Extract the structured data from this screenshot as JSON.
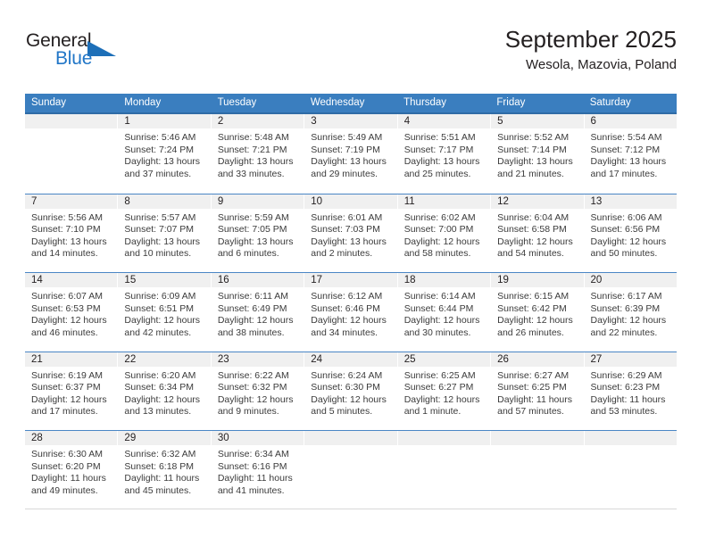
{
  "brand": {
    "name_part1": "General",
    "name_part2": "Blue",
    "triangle_color": "#1d6fb8",
    "blue_color": "#2176c7"
  },
  "header": {
    "title": "September 2025",
    "subtitle": "Wesola, Mazovia, Poland"
  },
  "calendar": {
    "header_bg": "#3a7ebf",
    "day_number_bg": "#f0f0f0",
    "weekdays": [
      "Sunday",
      "Monday",
      "Tuesday",
      "Wednesday",
      "Thursday",
      "Friday",
      "Saturday"
    ],
    "weeks": [
      [
        {
          "day": "",
          "sunrise": "",
          "sunset": "",
          "daylight_line1": "",
          "daylight_line2": ""
        },
        {
          "day": "1",
          "sunrise": "Sunrise: 5:46 AM",
          "sunset": "Sunset: 7:24 PM",
          "daylight_line1": "Daylight: 13 hours",
          "daylight_line2": "and 37 minutes."
        },
        {
          "day": "2",
          "sunrise": "Sunrise: 5:48 AM",
          "sunset": "Sunset: 7:21 PM",
          "daylight_line1": "Daylight: 13 hours",
          "daylight_line2": "and 33 minutes."
        },
        {
          "day": "3",
          "sunrise": "Sunrise: 5:49 AM",
          "sunset": "Sunset: 7:19 PM",
          "daylight_line1": "Daylight: 13 hours",
          "daylight_line2": "and 29 minutes."
        },
        {
          "day": "4",
          "sunrise": "Sunrise: 5:51 AM",
          "sunset": "Sunset: 7:17 PM",
          "daylight_line1": "Daylight: 13 hours",
          "daylight_line2": "and 25 minutes."
        },
        {
          "day": "5",
          "sunrise": "Sunrise: 5:52 AM",
          "sunset": "Sunset: 7:14 PM",
          "daylight_line1": "Daylight: 13 hours",
          "daylight_line2": "and 21 minutes."
        },
        {
          "day": "6",
          "sunrise": "Sunrise: 5:54 AM",
          "sunset": "Sunset: 7:12 PM",
          "daylight_line1": "Daylight: 13 hours",
          "daylight_line2": "and 17 minutes."
        }
      ],
      [
        {
          "day": "7",
          "sunrise": "Sunrise: 5:56 AM",
          "sunset": "Sunset: 7:10 PM",
          "daylight_line1": "Daylight: 13 hours",
          "daylight_line2": "and 14 minutes."
        },
        {
          "day": "8",
          "sunrise": "Sunrise: 5:57 AM",
          "sunset": "Sunset: 7:07 PM",
          "daylight_line1": "Daylight: 13 hours",
          "daylight_line2": "and 10 minutes."
        },
        {
          "day": "9",
          "sunrise": "Sunrise: 5:59 AM",
          "sunset": "Sunset: 7:05 PM",
          "daylight_line1": "Daylight: 13 hours",
          "daylight_line2": "and 6 minutes."
        },
        {
          "day": "10",
          "sunrise": "Sunrise: 6:01 AM",
          "sunset": "Sunset: 7:03 PM",
          "daylight_line1": "Daylight: 13 hours",
          "daylight_line2": "and 2 minutes."
        },
        {
          "day": "11",
          "sunrise": "Sunrise: 6:02 AM",
          "sunset": "Sunset: 7:00 PM",
          "daylight_line1": "Daylight: 12 hours",
          "daylight_line2": "and 58 minutes."
        },
        {
          "day": "12",
          "sunrise": "Sunrise: 6:04 AM",
          "sunset": "Sunset: 6:58 PM",
          "daylight_line1": "Daylight: 12 hours",
          "daylight_line2": "and 54 minutes."
        },
        {
          "day": "13",
          "sunrise": "Sunrise: 6:06 AM",
          "sunset": "Sunset: 6:56 PM",
          "daylight_line1": "Daylight: 12 hours",
          "daylight_line2": "and 50 minutes."
        }
      ],
      [
        {
          "day": "14",
          "sunrise": "Sunrise: 6:07 AM",
          "sunset": "Sunset: 6:53 PM",
          "daylight_line1": "Daylight: 12 hours",
          "daylight_line2": "and 46 minutes."
        },
        {
          "day": "15",
          "sunrise": "Sunrise: 6:09 AM",
          "sunset": "Sunset: 6:51 PM",
          "daylight_line1": "Daylight: 12 hours",
          "daylight_line2": "and 42 minutes."
        },
        {
          "day": "16",
          "sunrise": "Sunrise: 6:11 AM",
          "sunset": "Sunset: 6:49 PM",
          "daylight_line1": "Daylight: 12 hours",
          "daylight_line2": "and 38 minutes."
        },
        {
          "day": "17",
          "sunrise": "Sunrise: 6:12 AM",
          "sunset": "Sunset: 6:46 PM",
          "daylight_line1": "Daylight: 12 hours",
          "daylight_line2": "and 34 minutes."
        },
        {
          "day": "18",
          "sunrise": "Sunrise: 6:14 AM",
          "sunset": "Sunset: 6:44 PM",
          "daylight_line1": "Daylight: 12 hours",
          "daylight_line2": "and 30 minutes."
        },
        {
          "day": "19",
          "sunrise": "Sunrise: 6:15 AM",
          "sunset": "Sunset: 6:42 PM",
          "daylight_line1": "Daylight: 12 hours",
          "daylight_line2": "and 26 minutes."
        },
        {
          "day": "20",
          "sunrise": "Sunrise: 6:17 AM",
          "sunset": "Sunset: 6:39 PM",
          "daylight_line1": "Daylight: 12 hours",
          "daylight_line2": "and 22 minutes."
        }
      ],
      [
        {
          "day": "21",
          "sunrise": "Sunrise: 6:19 AM",
          "sunset": "Sunset: 6:37 PM",
          "daylight_line1": "Daylight: 12 hours",
          "daylight_line2": "and 17 minutes."
        },
        {
          "day": "22",
          "sunrise": "Sunrise: 6:20 AM",
          "sunset": "Sunset: 6:34 PM",
          "daylight_line1": "Daylight: 12 hours",
          "daylight_line2": "and 13 minutes."
        },
        {
          "day": "23",
          "sunrise": "Sunrise: 6:22 AM",
          "sunset": "Sunset: 6:32 PM",
          "daylight_line1": "Daylight: 12 hours",
          "daylight_line2": "and 9 minutes."
        },
        {
          "day": "24",
          "sunrise": "Sunrise: 6:24 AM",
          "sunset": "Sunset: 6:30 PM",
          "daylight_line1": "Daylight: 12 hours",
          "daylight_line2": "and 5 minutes."
        },
        {
          "day": "25",
          "sunrise": "Sunrise: 6:25 AM",
          "sunset": "Sunset: 6:27 PM",
          "daylight_line1": "Daylight: 12 hours",
          "daylight_line2": "and 1 minute."
        },
        {
          "day": "26",
          "sunrise": "Sunrise: 6:27 AM",
          "sunset": "Sunset: 6:25 PM",
          "daylight_line1": "Daylight: 11 hours",
          "daylight_line2": "and 57 minutes."
        },
        {
          "day": "27",
          "sunrise": "Sunrise: 6:29 AM",
          "sunset": "Sunset: 6:23 PM",
          "daylight_line1": "Daylight: 11 hours",
          "daylight_line2": "and 53 minutes."
        }
      ],
      [
        {
          "day": "28",
          "sunrise": "Sunrise: 6:30 AM",
          "sunset": "Sunset: 6:20 PM",
          "daylight_line1": "Daylight: 11 hours",
          "daylight_line2": "and 49 minutes."
        },
        {
          "day": "29",
          "sunrise": "Sunrise: 6:32 AM",
          "sunset": "Sunset: 6:18 PM",
          "daylight_line1": "Daylight: 11 hours",
          "daylight_line2": "and 45 minutes."
        },
        {
          "day": "30",
          "sunrise": "Sunrise: 6:34 AM",
          "sunset": "Sunset: 6:16 PM",
          "daylight_line1": "Daylight: 11 hours",
          "daylight_line2": "and 41 minutes."
        },
        {
          "day": "",
          "sunrise": "",
          "sunset": "",
          "daylight_line1": "",
          "daylight_line2": ""
        },
        {
          "day": "",
          "sunrise": "",
          "sunset": "",
          "daylight_line1": "",
          "daylight_line2": ""
        },
        {
          "day": "",
          "sunrise": "",
          "sunset": "",
          "daylight_line1": "",
          "daylight_line2": ""
        },
        {
          "day": "",
          "sunrise": "",
          "sunset": "",
          "daylight_line1": "",
          "daylight_line2": ""
        }
      ]
    ]
  }
}
